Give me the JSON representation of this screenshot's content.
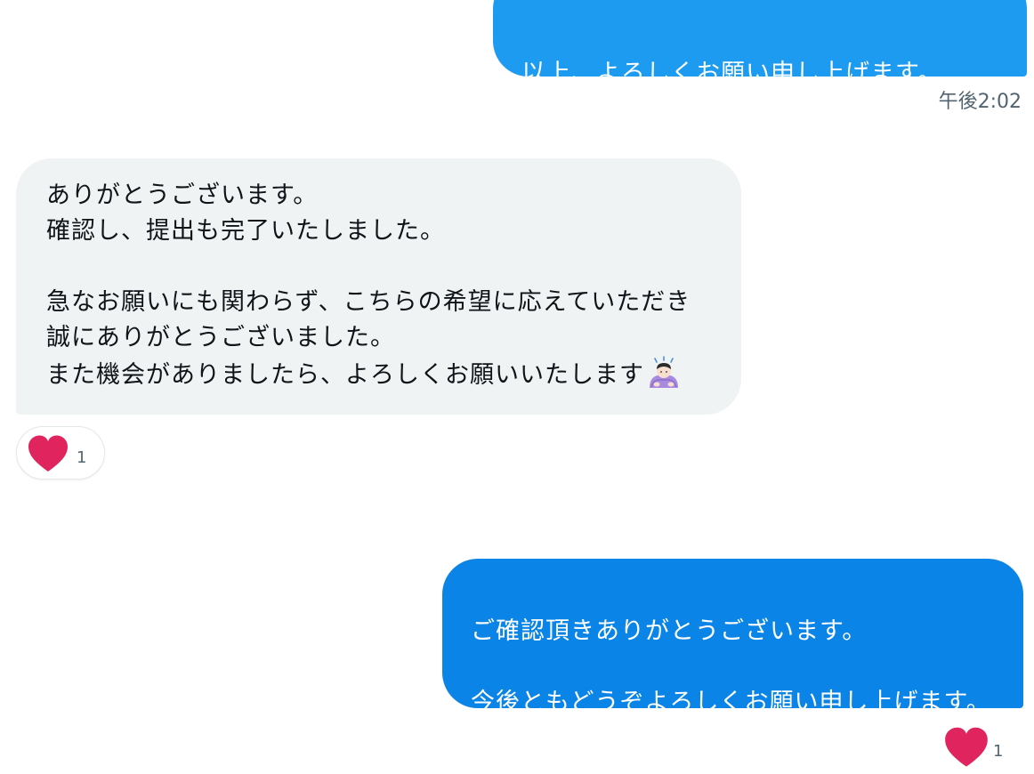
{
  "messages": [
    {
      "direction": "sent",
      "text": "以上、よろしくお願い申し上げます。",
      "timestamp": "午後2:02"
    },
    {
      "direction": "received",
      "text": "ありがとうございます。\n確認し、提出も完了いたしました。\n\n急なお願いにも関わらず、こちらの希望に応えていただき\n誠にありがとうございました。\nまた機会がありましたら、よろしくお願いいたします",
      "emoji": "person-bowing-emoji",
      "reaction": {
        "icon": "heart-icon",
        "count": "1"
      }
    },
    {
      "direction": "sent",
      "text": "ご確認頂きありがとうございます。\n\n今後ともどうぞよろしくお願い申し上げます。",
      "reaction": {
        "icon": "heart-icon",
        "count": "1"
      }
    }
  ],
  "colors": {
    "sent_bubble_top": "#1d9bf0",
    "sent_bubble_bottom": "#0a84e6",
    "received_bubble": "#eff3f4",
    "heart": "#e0245e",
    "timestamp": "#536471"
  }
}
